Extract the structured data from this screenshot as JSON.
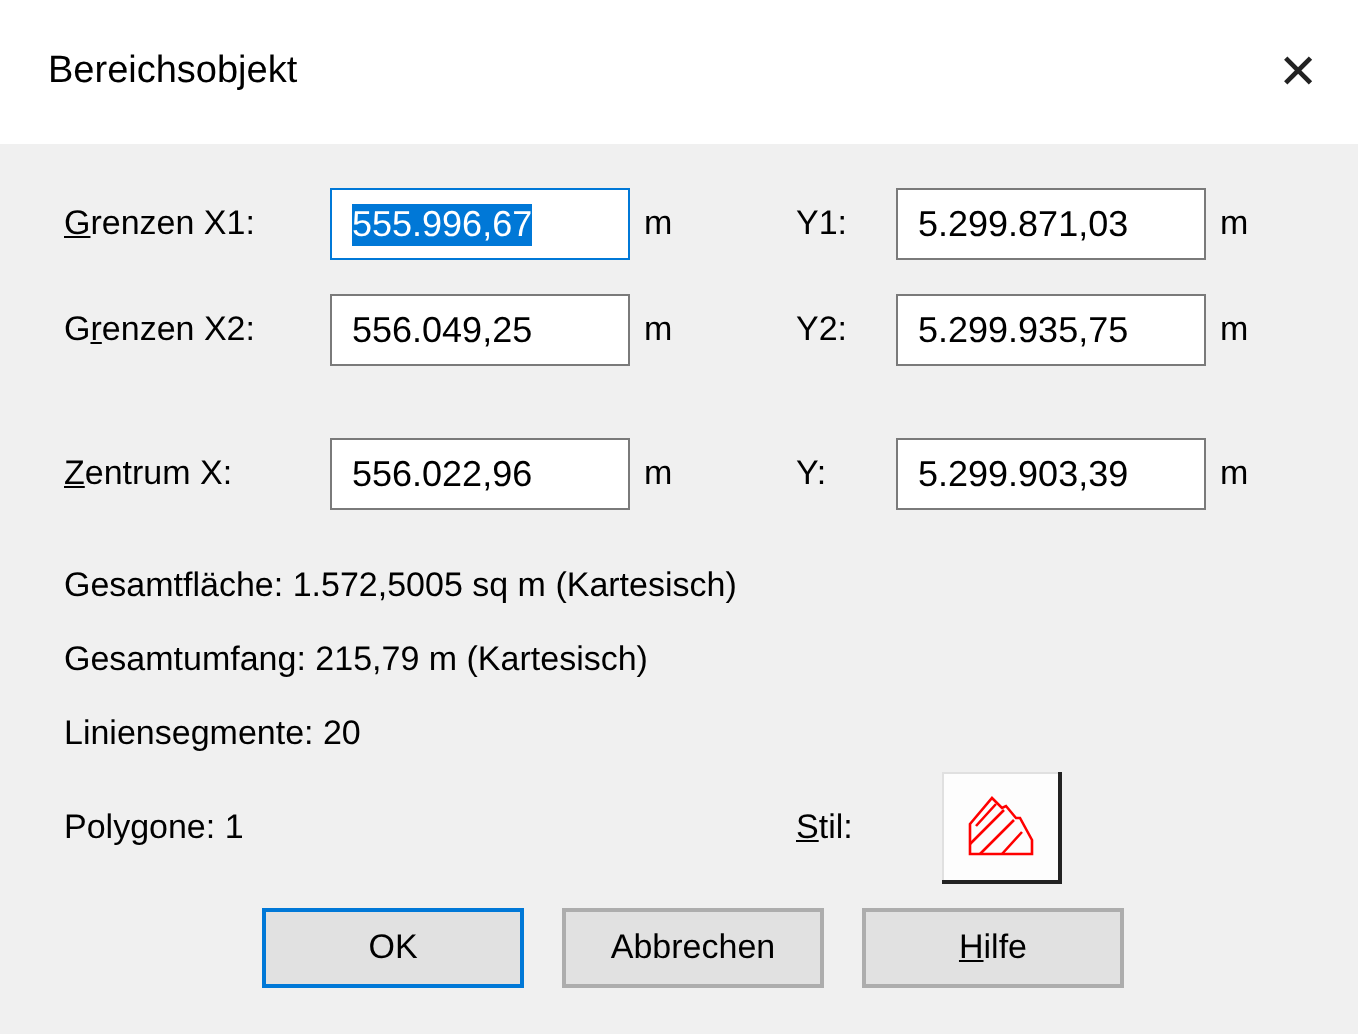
{
  "window": {
    "title": "Bereichsobjekt",
    "close": "✕"
  },
  "fields": [
    {
      "label": {
        "key": "G",
        "post": "renzen X1:"
      },
      "value": "555.996,67",
      "unit": "m",
      "focused": true,
      "y_label": {
        "post": "Y1:"
      },
      "y_value": "5.299.871,03",
      "y_unit": "m"
    },
    {
      "label": {
        "pre": "G",
        "key": "r",
        "post": "enzen X2:"
      },
      "value": "556.049,25",
      "unit": "m",
      "focused": false,
      "y_label": {
        "post": "Y2:"
      },
      "y_value": "5.299.935,75",
      "y_unit": "m"
    },
    {
      "label": {
        "key": "Z",
        "post": "entrum X:"
      },
      "value": "556.022,96",
      "unit": "m",
      "focused": false,
      "y_label": {
        "post": "Y:"
      },
      "y_value": "5.299.903,39",
      "y_unit": "m"
    }
  ],
  "info": [
    "Gesamtfläche:  1.572,5005 sq m (Kartesisch)",
    "Gesamtumfang:  215,79 m (Kartesisch)",
    "Liniensegmente:  20",
    "Polygone:  1"
  ],
  "style": {
    "label": {
      "key": "S",
      "post": "til:"
    }
  },
  "buttons": [
    {
      "label": {
        "post": "OK"
      },
      "default": true
    },
    {
      "label": {
        "post": "Abbrechen"
      },
      "default": false
    },
    {
      "label": {
        "key": "H",
        "post": "ilfe"
      },
      "default": false
    }
  ]
}
